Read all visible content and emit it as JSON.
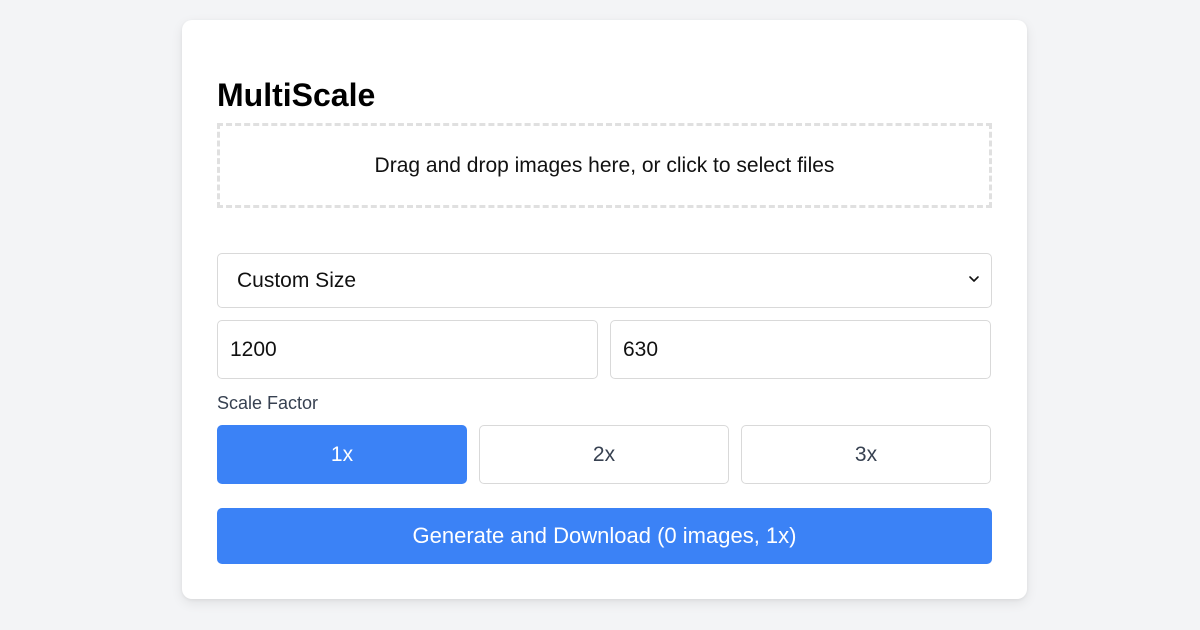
{
  "app": {
    "title": "MultiScale"
  },
  "dropzone": {
    "text": "Drag and drop images here, or click to select files"
  },
  "size_select": {
    "selected": "Custom Size",
    "icon": "chevron-down-icon"
  },
  "dimensions": {
    "width": "1200",
    "height": "630"
  },
  "scale": {
    "label": "Scale Factor",
    "options": [
      "1x",
      "2x",
      "3x"
    ],
    "selected": "1x"
  },
  "generate": {
    "label": "Generate and Download (0 images, 1x)"
  },
  "colors": {
    "accent": "#3b82f6",
    "background": "#f3f4f6",
    "card": "#ffffff"
  }
}
